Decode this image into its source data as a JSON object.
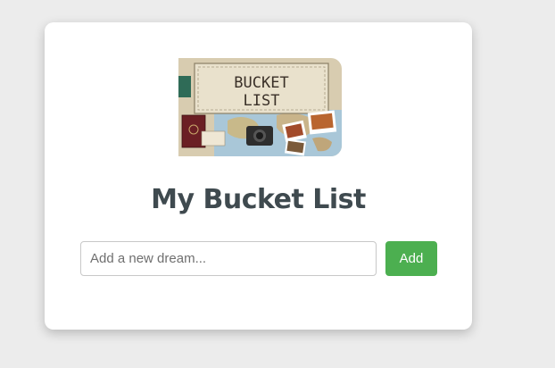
{
  "header": {
    "image_text_line1": "BUCKET",
    "image_text_line2": "LIST",
    "title": "My Bucket List"
  },
  "form": {
    "input_placeholder": "Add a new dream...",
    "input_value": "",
    "add_label": "Add"
  },
  "colors": {
    "background": "#ececec",
    "card": "#ffffff",
    "title": "#3f4a4f",
    "button": "#4caf50",
    "button_text": "#ffffff"
  }
}
